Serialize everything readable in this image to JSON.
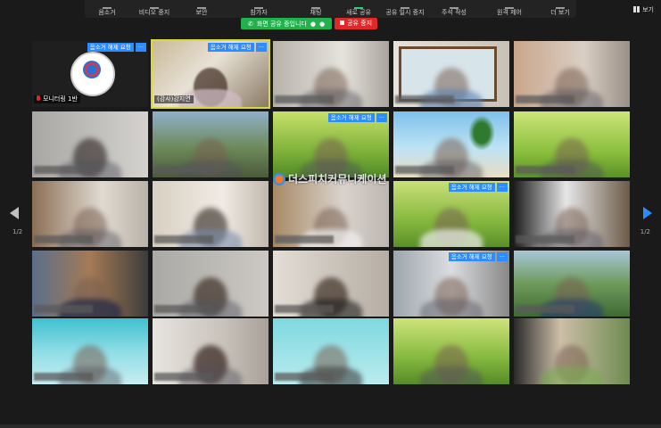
{
  "toolbar": {
    "items": [
      "음소거",
      "비디오 중지",
      "보안",
      "참가자",
      "채팅",
      "새로 공유",
      "공유 일시 중지",
      "주석 작성",
      "원격 제어",
      "더 보기"
    ],
    "view_label": "보기"
  },
  "share_bar": {
    "status": "화면 공유 중입니다",
    "stop": "공유 중지"
  },
  "tiles": {
    "mute_request": "음소거 해제 요청",
    "more": "···",
    "host_name": "모니터링 1반",
    "speaker_name": "(강사)강지연"
  },
  "watermark": "더스피치커뮤니케이션",
  "nav": {
    "left_page": "1/2",
    "right_page": "1/2"
  },
  "colors": {
    "accent": "#2d8cff",
    "share_green": "#22b14c",
    "stop_red": "#e02828",
    "active_outline": "#d8d83a"
  }
}
